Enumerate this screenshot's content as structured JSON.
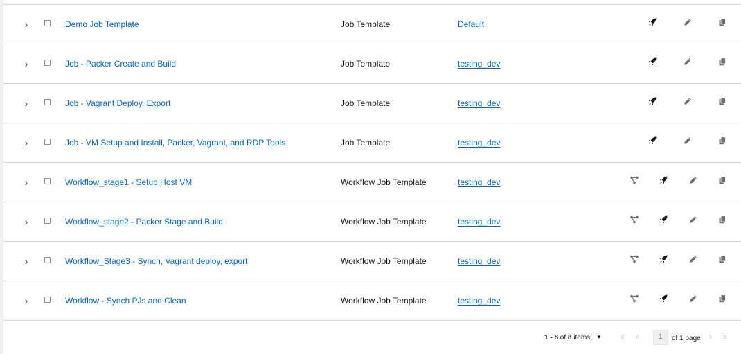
{
  "rows": [
    {
      "name": "Demo Job Template",
      "type": "Job Template",
      "inventory": "Default",
      "underline": false,
      "workflow": false
    },
    {
      "name": "Job - Packer Create and Build",
      "type": "Job Template",
      "inventory": "testing_dev",
      "underline": true,
      "workflow": false
    },
    {
      "name": "Job - Vagrant Deploy, Export",
      "type": "Job Template",
      "inventory": "testing_dev",
      "underline": true,
      "workflow": false
    },
    {
      "name": "Job - VM Setup and Install, Packer, Vagrant, and RDP Tools",
      "type": "Job Template",
      "inventory": "testing_dev",
      "underline": true,
      "workflow": false
    },
    {
      "name": "Workflow_stage1 - Setup Host VM",
      "type": "Workflow Job Template",
      "inventory": "testing_dev",
      "underline": true,
      "workflow": true
    },
    {
      "name": "Workflow_stage2 - Packer Stage and Build",
      "type": "Workflow Job Template",
      "inventory": "testing_dev",
      "underline": true,
      "workflow": true
    },
    {
      "name": "Workflow_Stage3 - Synch, Vagrant deploy, export",
      "type": "Workflow Job Template",
      "inventory": "testing_dev",
      "underline": true,
      "workflow": true
    },
    {
      "name": "Workflow - Synch PJs and Clean",
      "type": "Workflow Job Template",
      "inventory": "testing_dev",
      "underline": true,
      "workflow": true
    }
  ],
  "icons": {
    "expand": "chevron-right-icon",
    "visualizer": "workflow-visualizer-icon",
    "launch": "rocket-icon",
    "edit": "pencil-icon",
    "copy": "copy-icon"
  },
  "pagination": {
    "range": "1 - 8",
    "of_label": "of",
    "total": "8",
    "items_label": "items",
    "current_page": "1",
    "of_pages": "of 1 page"
  },
  "colors": {
    "link": "#0066cc",
    "border": "#d2d2d2",
    "icon": "#6a6e73"
  }
}
